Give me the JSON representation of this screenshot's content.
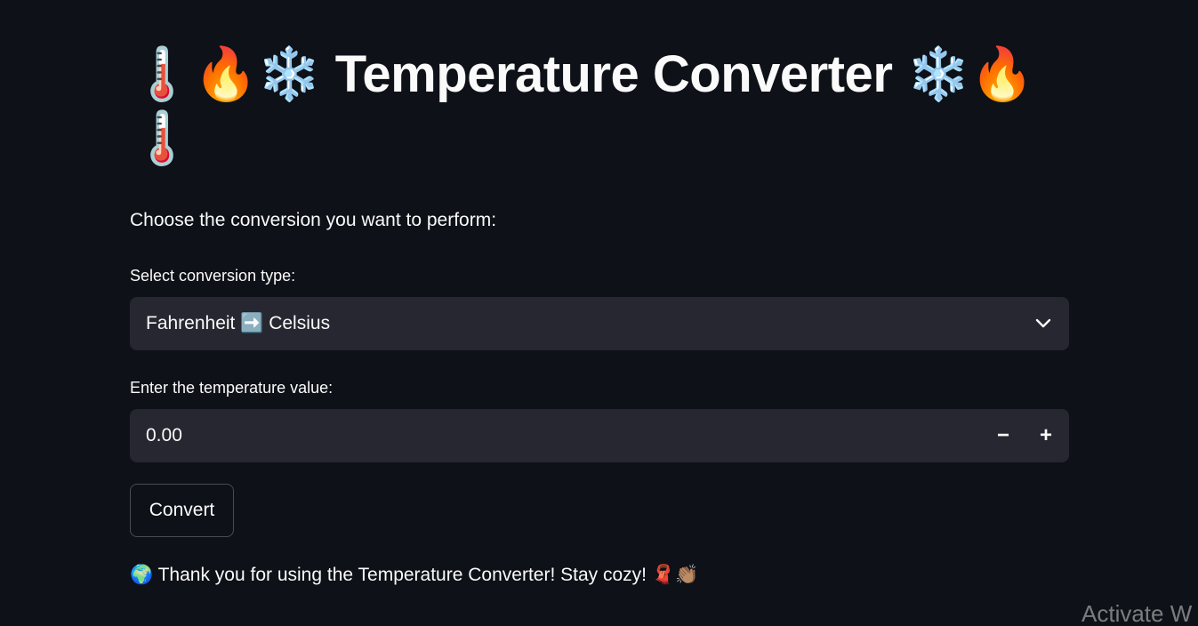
{
  "header": {
    "title": "🌡️🔥❄️ Temperature Converter ❄️🔥🌡️"
  },
  "main": {
    "prompt": "Choose the conversion you want to perform:",
    "select": {
      "label": "Select conversion type:",
      "value": "Fahrenheit ➡️ Celsius",
      "icon": "chevron-down-icon"
    },
    "number": {
      "label": "Enter the temperature value:",
      "value": "0.00",
      "decrement_label": "−",
      "increment_label": "+"
    },
    "convert_label": "Convert",
    "thanks": "🌍 Thank you for using the Temperature Converter! Stay cozy! 🧣👏🏽"
  },
  "watermark": "Activate W",
  "colors": {
    "background": "#0e1117",
    "input_background": "#262730",
    "text": "#fafafa"
  }
}
